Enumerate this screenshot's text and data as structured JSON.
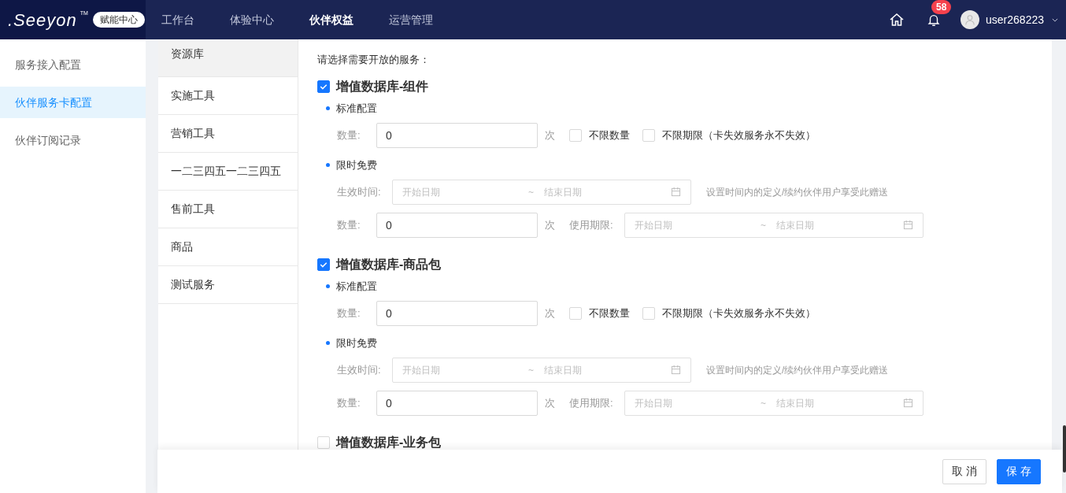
{
  "header": {
    "logo": ".Seeyon",
    "logo_tm": "TM",
    "badge": "赋能中心",
    "nav": [
      {
        "label": "工作台",
        "selected": false
      },
      {
        "label": "体验中心",
        "selected": false
      },
      {
        "label": "伙伴权益",
        "selected": true
      },
      {
        "label": "运营管理",
        "selected": false
      }
    ],
    "notifications": "58",
    "username": "user268223"
  },
  "sidebar": [
    {
      "label": "服务接入配置",
      "selected": false
    },
    {
      "label": "伙伴服务卡配置",
      "selected": true
    },
    {
      "label": "伙伴订阅记录",
      "selected": false
    }
  ],
  "categories": [
    {
      "label": "资源库",
      "selected": true
    },
    {
      "label": "实施工具",
      "selected": false
    },
    {
      "label": "营销工具",
      "selected": false
    },
    {
      "label": "一二三四五一二三四五",
      "selected": false
    },
    {
      "label": "售前工具",
      "selected": false
    },
    {
      "label": "商品",
      "selected": false
    },
    {
      "label": "测试服务",
      "selected": false
    }
  ],
  "prompt": "请选择需要开放的服务：",
  "services": [
    {
      "title": "增值数据库-组件",
      "checked": true,
      "standard": {
        "heading": "标准配置",
        "qty_label": "数量:",
        "qty": "0",
        "unit": "次",
        "options": [
          {
            "label": "不限数量",
            "checked": false
          },
          {
            "label": "不限期限（卡失效服务永不失效）",
            "checked": false
          }
        ]
      },
      "free": {
        "heading": "限时免费",
        "time_label": "生效时间:",
        "start": "开始日期",
        "sep": "~",
        "end": "结束日期",
        "hint": "设置时间内的定义/续约伙伴用户享受此赠送",
        "qty_label": "数量:",
        "qty": "0",
        "unit": "次",
        "period_label": "使用期限:",
        "period_start": "开始日期",
        "period_sep": "~",
        "period_end": "结束日期"
      }
    },
    {
      "title": "增值数据库-商品包",
      "checked": true,
      "standard": {
        "heading": "标准配置",
        "qty_label": "数量:",
        "qty": "0",
        "unit": "次",
        "options": [
          {
            "label": "不限数量",
            "checked": false
          },
          {
            "label": "不限期限（卡失效服务永不失效）",
            "checked": false
          }
        ]
      },
      "free": {
        "heading": "限时免费",
        "time_label": "生效时间:",
        "start": "开始日期",
        "sep": "~",
        "end": "结束日期",
        "hint": "设置时间内的定义/续约伙伴用户享受此赠送",
        "qty_label": "数量:",
        "qty": "0",
        "unit": "次",
        "period_label": "使用期限:",
        "period_start": "开始日期",
        "period_sep": "~",
        "period_end": "结束日期"
      }
    },
    {
      "title": "增值数据库-业务包",
      "checked": false
    }
  ],
  "footer": {
    "buttons": [
      {
        "label": "取 消",
        "kind": "secondary"
      },
      {
        "label": "保 存",
        "kind": "primary"
      }
    ]
  }
}
